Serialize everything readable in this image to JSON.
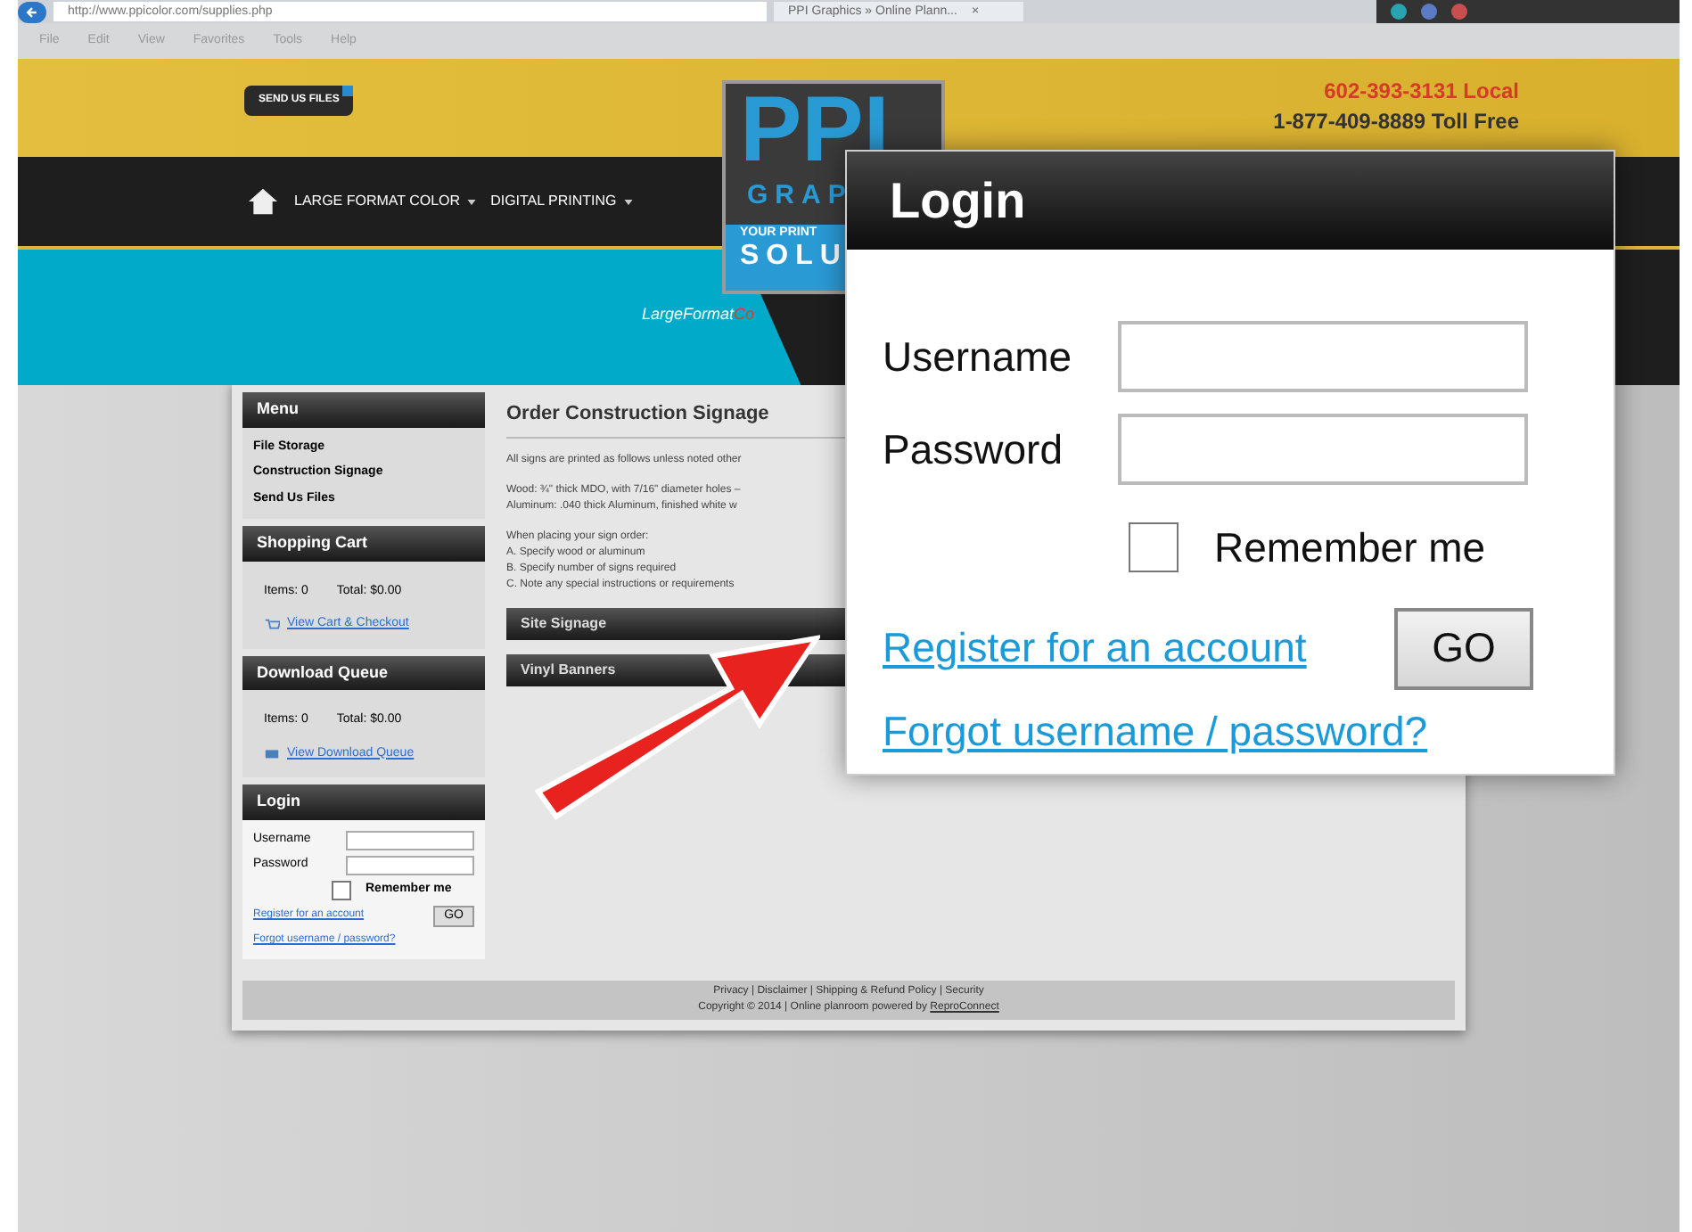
{
  "browser": {
    "address": "http://www.ppicolor.com/supplies.php",
    "tab": "PPI Graphics » Online Plann...",
    "tab_close": "×",
    "menu": [
      "File",
      "Edit",
      "View",
      "Favorites",
      "Tools",
      "Help"
    ]
  },
  "header": {
    "send_button": "SEND US FILES",
    "phone_local": "602-393-3131 Local",
    "phone_toll": "1-877-409-8889 Toll Free",
    "nav": [
      "LARGE FORMAT COLOR",
      "DIGITAL PRINTING"
    ],
    "logo": {
      "mark": "PPI",
      "word": "GRAP",
      "slogan": "YOUR PRINT",
      "slogan_big": "SOLU"
    },
    "tagline": "LargeFormat",
    "tagline_red": "Co"
  },
  "sidebar": {
    "menu": {
      "title": "Menu",
      "items": [
        "File Storage",
        "Construction Signage",
        "Send Us Files"
      ]
    },
    "cart": {
      "title": "Shopping Cart",
      "items": "Items: 0",
      "total": "Total: $0.00",
      "link": "View Cart & Checkout"
    },
    "queue": {
      "title": "Download Queue",
      "items": "Items: 0",
      "total": "Total: $0.00",
      "link": "View Download Queue"
    },
    "login": {
      "title": "Login",
      "username": "Username",
      "password": "Password",
      "remember": "Remember me",
      "checked": false,
      "register": "Register for an account",
      "go": "GO",
      "forgot": "Forgot username / password?"
    }
  },
  "main": {
    "title": "Order Construction Signage",
    "paragraphs": [
      [
        "All signs are printed as follows unless noted other"
      ],
      [
        "Wood: ¾\" thick MDO, with 7/16\" diameter holes –",
        "Aluminum: .040 thick Aluminum, finished white w"
      ],
      [
        "When placing your sign order:",
        "A. Specify wood or aluminum",
        "B. Specify number of signs required",
        "C. Note any special instructions or requirements"
      ]
    ],
    "sections": [
      "Site Signage",
      "Vinyl Banners"
    ]
  },
  "footer": {
    "links": "Privacy | Disclaimer | Shipping & Refund Policy | Security",
    "copyright": "Copyright © 2014  |  Online planroom powered by",
    "powered_link": "ReproConnect"
  },
  "popup": {
    "title": "Login",
    "username": "Username",
    "password": "Password",
    "remember": "Remember me",
    "checked": false,
    "register": "Register for an account",
    "go": "GO",
    "forgot": "Forgot username / password?"
  }
}
